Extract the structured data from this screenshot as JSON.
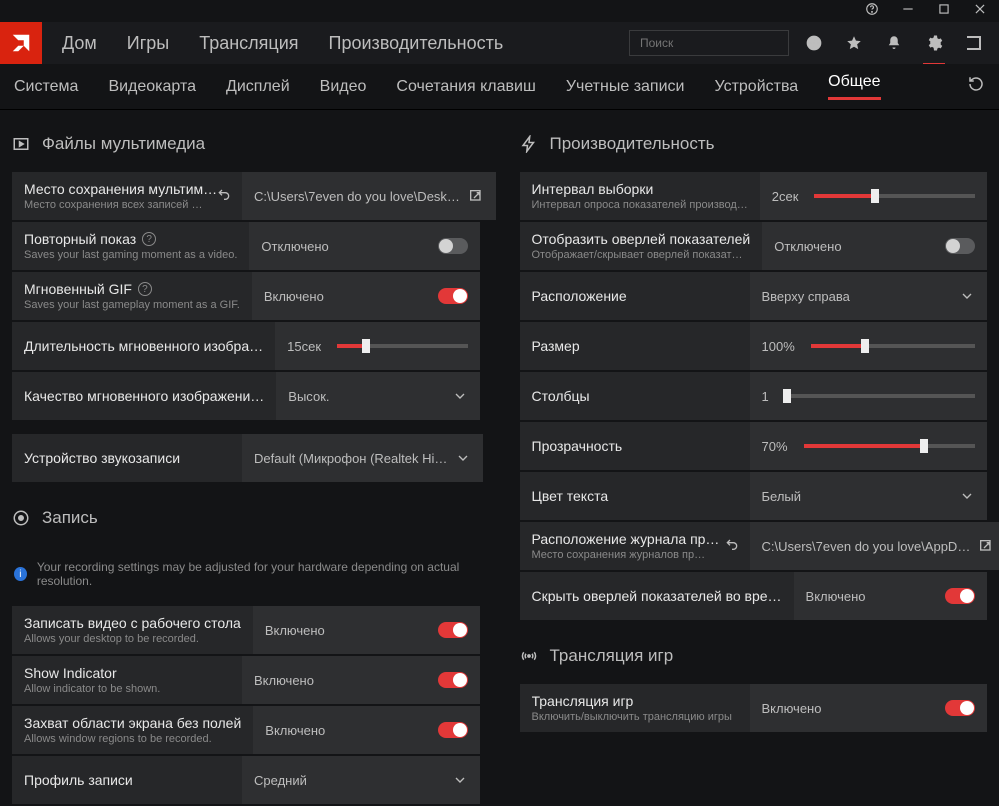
{
  "search": {
    "placeholder": "Поиск"
  },
  "mainnav": [
    "Дом",
    "Игры",
    "Трансляция",
    "Производительность"
  ],
  "subnav": [
    "Система",
    "Видеокарта",
    "Дисплей",
    "Видео",
    "Сочетания клавиш",
    "Учетные записи",
    "Устройства",
    "Общее"
  ],
  "subnav_active": 7,
  "left": {
    "sec_media": "Файлы мультимедиа",
    "save_loc": {
      "ttl": "Место сохранения мультим…",
      "sub": "Место сохранения всех записей …",
      "path": "C:\\Users\\7even do you love\\Desk…"
    },
    "replay": {
      "ttl": "Повторный показ",
      "sub": "Saves your last gaming moment as a video.",
      "val": "Отключено"
    },
    "gif": {
      "ttl": "Мгновенный GIF",
      "sub": "Saves your last gameplay moment as a GIF.",
      "val": "Включено"
    },
    "gif_dur": {
      "ttl": "Длительность мгновенного изобра…",
      "val": "15сек",
      "pct": 22
    },
    "gif_qual": {
      "ttl": "Качество мгновенного изображени…",
      "val": "Высок."
    },
    "audio_dev": {
      "ttl": "Устройство звукозаписи",
      "val": "Default (Микрофон (Realtek Hi…"
    },
    "sec_record": "Запись",
    "rec_info": "Your recording settings may be adjusted for your hardware depending on actual resolution.",
    "rec_desk": {
      "ttl": "Записать видео с рабочего стола",
      "sub": "Allows your desktop to be recorded.",
      "val": "Включено"
    },
    "rec_ind": {
      "ttl": "Show Indicator",
      "sub": "Allow indicator to be shown.",
      "val": "Включено"
    },
    "rec_region": {
      "ttl": "Захват области экрана без полей",
      "sub": "Allows window regions to be recorded.",
      "val": "Включено"
    },
    "rec_profile": {
      "ttl": "Профиль записи",
      "val": "Средний"
    }
  },
  "right": {
    "sec_perf": "Производительность",
    "samp": {
      "ttl": "Интервал выборки",
      "sub": "Интервал опроса показателей производ…",
      "val": "2сек",
      "pct": 38
    },
    "overlay": {
      "ttl": "Отобразить оверлей показателей",
      "sub": "Отображает/скрывает оверлей показат…",
      "val": "Отключено"
    },
    "pos": {
      "ttl": "Расположение",
      "val": "Вверху справа"
    },
    "size": {
      "ttl": "Размер",
      "val": "100%",
      "pct": 33
    },
    "cols": {
      "ttl": "Столбцы",
      "val": "1",
      "pct": 1
    },
    "opacity": {
      "ttl": "Прозрачность",
      "val": "70%",
      "pct": 70
    },
    "txtcolor": {
      "ttl": "Цвет текста",
      "val": "Белый"
    },
    "log": {
      "ttl": "Расположение журнала пр…",
      "sub": "Место сохранения журналов пр…",
      "path": "C:\\Users\\7even do you love\\AppD…"
    },
    "hide_ovl": {
      "ttl": "Скрыть оверлей показателей во вре…",
      "val": "Включено"
    },
    "sec_stream": "Трансляция игр",
    "stream": {
      "ttl": "Трансляция игр",
      "sub": "Включить/выключить трансляцию игры",
      "val": "Включено"
    }
  }
}
